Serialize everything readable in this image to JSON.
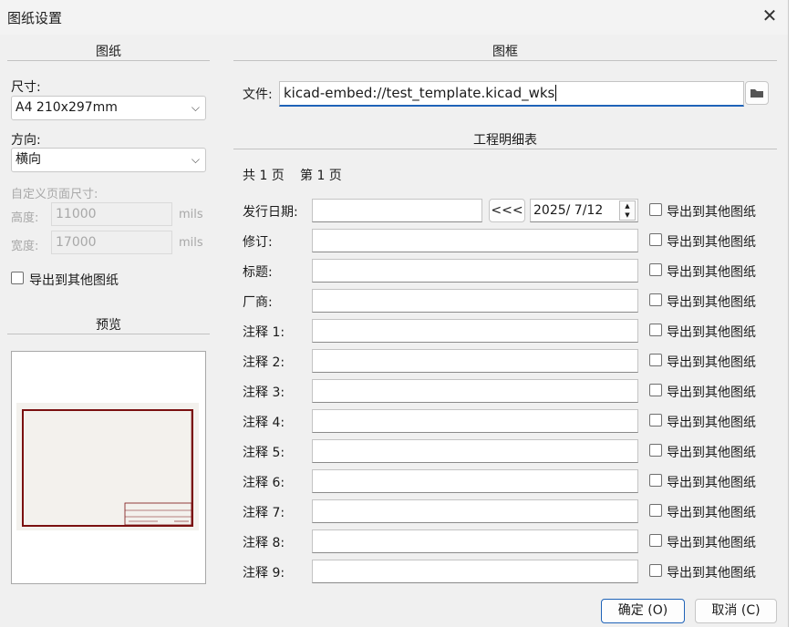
{
  "window": {
    "title": "图纸设置"
  },
  "left": {
    "section_title": "图纸",
    "size": {
      "label": "尺寸:",
      "value": "A4 210x297mm"
    },
    "orientation": {
      "label": "方向:",
      "value": "横向"
    },
    "custom_size": {
      "label": "自定义页面尺寸:",
      "height": {
        "label": "高度:",
        "value": "11000",
        "unit": "mils"
      },
      "width": {
        "label": "宽度:",
        "value": "17000",
        "unit": "mils"
      }
    },
    "export_label": "导出到其他图纸",
    "preview_title": "预览"
  },
  "right": {
    "frame_title": "图框",
    "file_label": "文件:",
    "file_value": "kicad-embed://test_template.kicad_wks",
    "title_block_title": "工程明细表",
    "page_total": "共 1 页",
    "page_current": "第 1 页",
    "date_label": "发行日期:",
    "date_button": "<<<",
    "date_value": "2025/  7/12",
    "export_label": "导出到其他图纸",
    "fields": [
      {
        "label": "修订:",
        "value": ""
      },
      {
        "label": "标题:",
        "value": ""
      },
      {
        "label": "厂商:",
        "value": ""
      },
      {
        "label": "注释 1:",
        "value": ""
      },
      {
        "label": "注释 2:",
        "value": ""
      },
      {
        "label": "注释 3:",
        "value": ""
      },
      {
        "label": "注释 4:",
        "value": ""
      },
      {
        "label": "注释 5:",
        "value": ""
      },
      {
        "label": "注释 6:",
        "value": ""
      },
      {
        "label": "注释 7:",
        "value": ""
      },
      {
        "label": "注释 8:",
        "value": ""
      },
      {
        "label": "注释 9:",
        "value": ""
      }
    ]
  },
  "buttons": {
    "ok": "确定 (O)",
    "cancel": "取消 (C)"
  },
  "icons": {
    "close": "close-icon",
    "folder": "folder-icon",
    "chevron": "chevron-down-icon",
    "spin": "spin-updown-icon"
  }
}
